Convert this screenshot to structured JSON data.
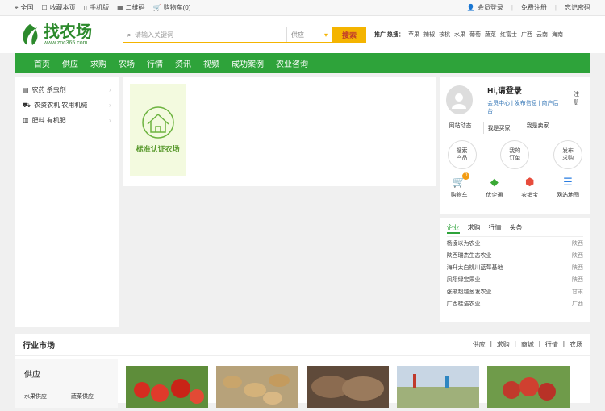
{
  "topbar": {
    "left": [
      {
        "icon": "location-icon",
        "label": "全国"
      },
      {
        "icon": "bookmark-icon",
        "label": "收藏本页"
      },
      {
        "icon": "phone-icon",
        "label": "手机版"
      },
      {
        "icon": "qrcode-icon",
        "label": "二维码"
      },
      {
        "icon": "cart-icon",
        "label": "购物车(0)"
      }
    ],
    "right": {
      "login": "会员登录",
      "register": "免费注册",
      "forgot": "忘记密码"
    }
  },
  "header": {
    "logo_text": "找农场",
    "logo_sub": "www.znc365.com",
    "search_placeholder": "请输入关键词",
    "search_type": "供应",
    "search_button": "搜索",
    "hot_label": "推广 热搜：",
    "hot_items": [
      "苹果",
      "辣椒",
      "核桃",
      "水果",
      "葡萄",
      "蔬菜",
      "红富士",
      "广西",
      "云南",
      "海南"
    ]
  },
  "nav": [
    "首页",
    "供应",
    "求购",
    "农场",
    "行情",
    "资讯",
    "视频",
    "成功案例",
    "农业咨询"
  ],
  "categories": [
    {
      "icon": "pesticide-icon",
      "label": "农药 杀虫剂"
    },
    {
      "icon": "tractor-icon",
      "label": "农资农机 农用机械"
    },
    {
      "icon": "fertilizer-icon",
      "label": "肥料 有机肥"
    }
  ],
  "farm_card": {
    "title": "标准认证农场"
  },
  "user": {
    "greeting": "Hi,请登录",
    "register": "注册",
    "links": [
      "会员中心",
      "发布信息",
      "商户后台"
    ],
    "tabs": [
      "网站动态",
      "我是买家",
      "我是卖家"
    ],
    "actions": [
      [
        "搜索",
        "产品"
      ],
      [
        "我的",
        "订单"
      ],
      [
        "发布",
        "求购"
      ]
    ],
    "tools": [
      {
        "icon": "cart-icon",
        "label": "购物车",
        "badge": "0"
      },
      {
        "icon": "youqitong-icon",
        "label": "优企通"
      },
      {
        "icon": "nongxiaobao-icon",
        "label": "农销宝"
      },
      {
        "icon": "sitemap-icon",
        "label": "网站地图"
      }
    ]
  },
  "news": {
    "tabs": [
      "企业",
      "求购",
      "行情",
      "头条"
    ],
    "rows": [
      {
        "name": "杨凌以为农业",
        "prov": "陕西"
      },
      {
        "name": "陕西瑞杰生态农业",
        "prov": "陕西"
      },
      {
        "name": "海升太白桃川蓝莓基地",
        "prov": "陕西"
      },
      {
        "name": "凤翔绿宝果业",
        "prov": "陕西"
      },
      {
        "name": "张掖超越葱发农业",
        "prov": "甘肃"
      },
      {
        "name": "广西桂洁农业",
        "prov": "广西"
      }
    ]
  },
  "market": {
    "title": "行业市场",
    "links": [
      "供应",
      "求购",
      "商城",
      "行情",
      "农场"
    ],
    "side_title": "供应",
    "side_items": [
      "水果供应",
      "蔬菜供应"
    ]
  },
  "colors": {
    "green": "#2ea33a",
    "yellow": "#f4b400"
  }
}
